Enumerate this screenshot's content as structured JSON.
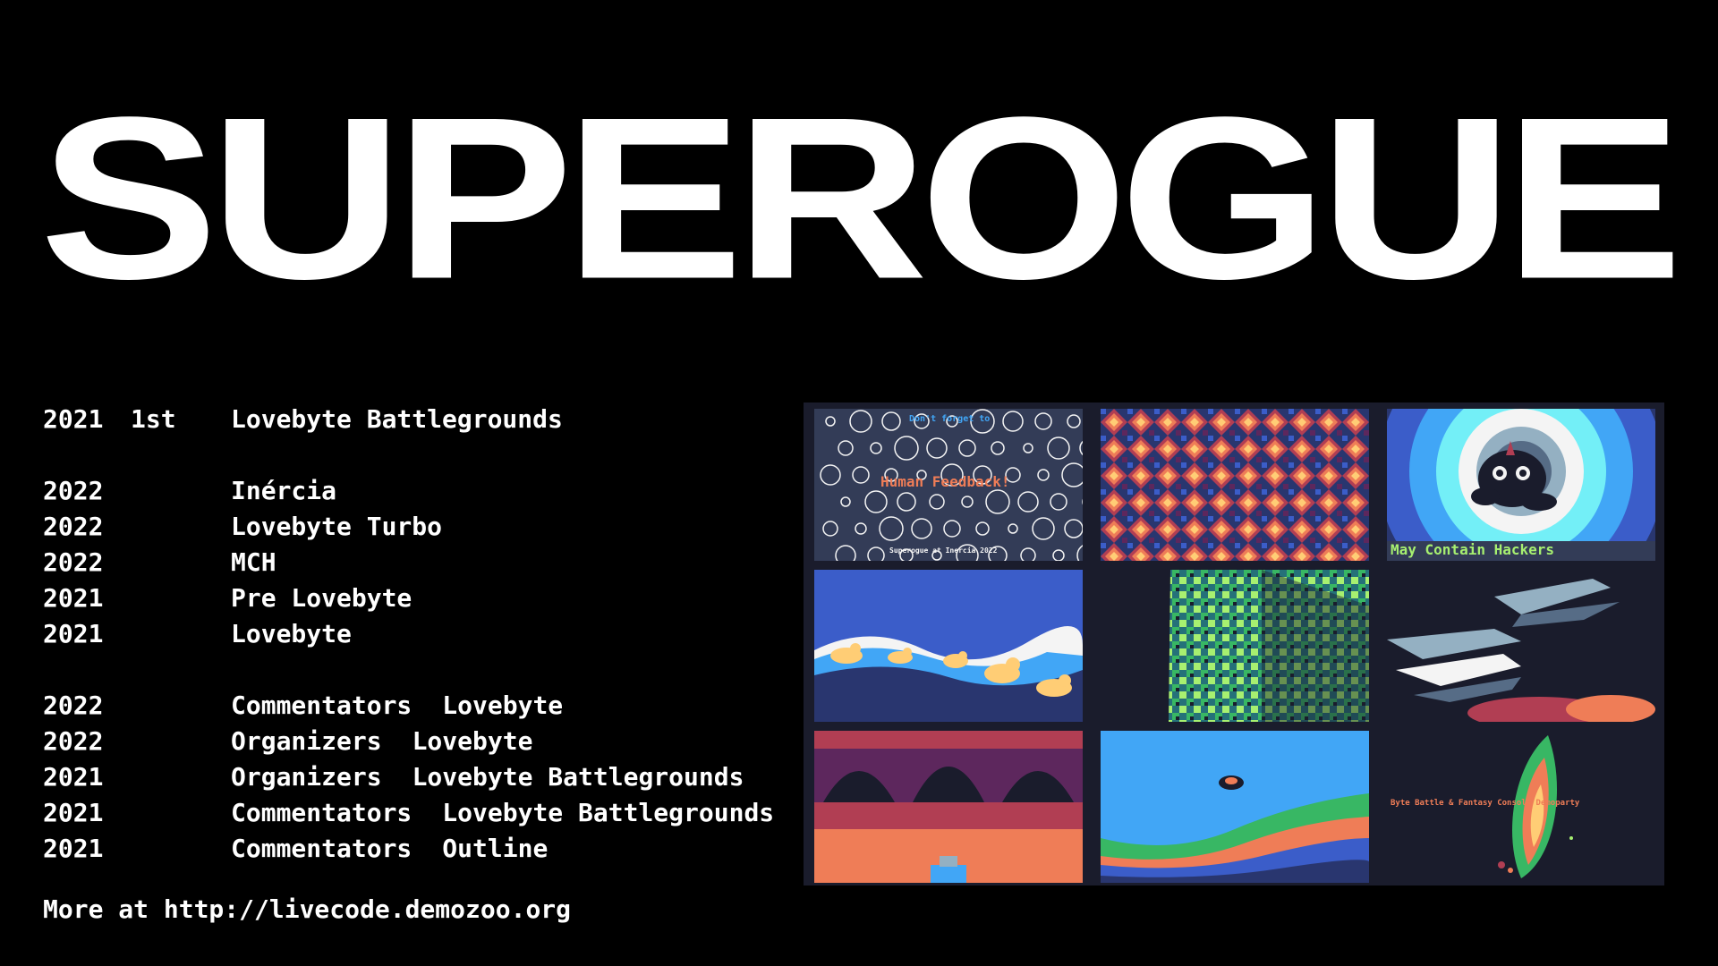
{
  "title": "SUPEROGUE",
  "results": [
    {
      "year": "2021",
      "place": "1st",
      "event": "Lovebyte Battlegrounds"
    }
  ],
  "participations": [
    {
      "year": "2022",
      "event": "Inércia"
    },
    {
      "year": "2022",
      "event": "Lovebyte Turbo"
    },
    {
      "year": "2022",
      "event": "MCH"
    },
    {
      "year": "2021",
      "event": "Pre Lovebyte"
    },
    {
      "year": "2021",
      "event": "Lovebyte"
    }
  ],
  "roles": [
    {
      "year": "2022",
      "role": "Commentators",
      "event": "Lovebyte"
    },
    {
      "year": "2022",
      "role": "Organizers",
      "event": "Lovebyte"
    },
    {
      "year": "2021",
      "role": "Organizers",
      "event": "Lovebyte Battlegrounds"
    },
    {
      "year": "2021",
      "role": "Commentators",
      "event": "Lovebyte Battlegrounds"
    },
    {
      "year": "2021",
      "role": "Commentators",
      "event": "Outline"
    }
  ],
  "footer": "More at http://livecode.demozoo.org",
  "screenshots": {
    "s1_top": "Don't forget to",
    "s1_mid": "Human Feedback!",
    "s1_bottom": "Superogue at Inercia 2022",
    "s3_caption": "May Contain Hackers",
    "s9_caption": "Byte Battle & Fantasy Console Demoparty"
  }
}
